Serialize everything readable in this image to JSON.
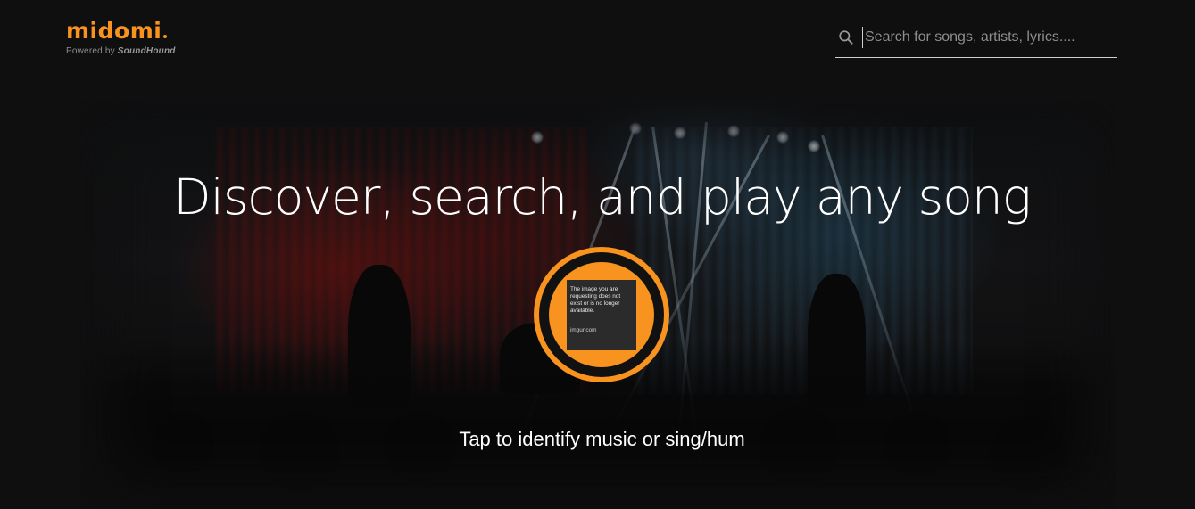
{
  "brand": {
    "logo_text": "midomi",
    "powered_by_prefix": "Powered by",
    "powered_by_name": "SoundHound",
    "accent_color": "#f7931e"
  },
  "search": {
    "placeholder": "Search for songs, artists, lyrics....",
    "value": "",
    "icon": "search-icon"
  },
  "hero": {
    "headline": "Discover, search, and play any song",
    "listen_button": {
      "icon": "broken-image-placeholder",
      "placeholder_text": "The image you are requesting does not exist or is no longer available.",
      "placeholder_source": "imgur.com"
    },
    "cta": "Tap to identify music or sing/hum"
  }
}
